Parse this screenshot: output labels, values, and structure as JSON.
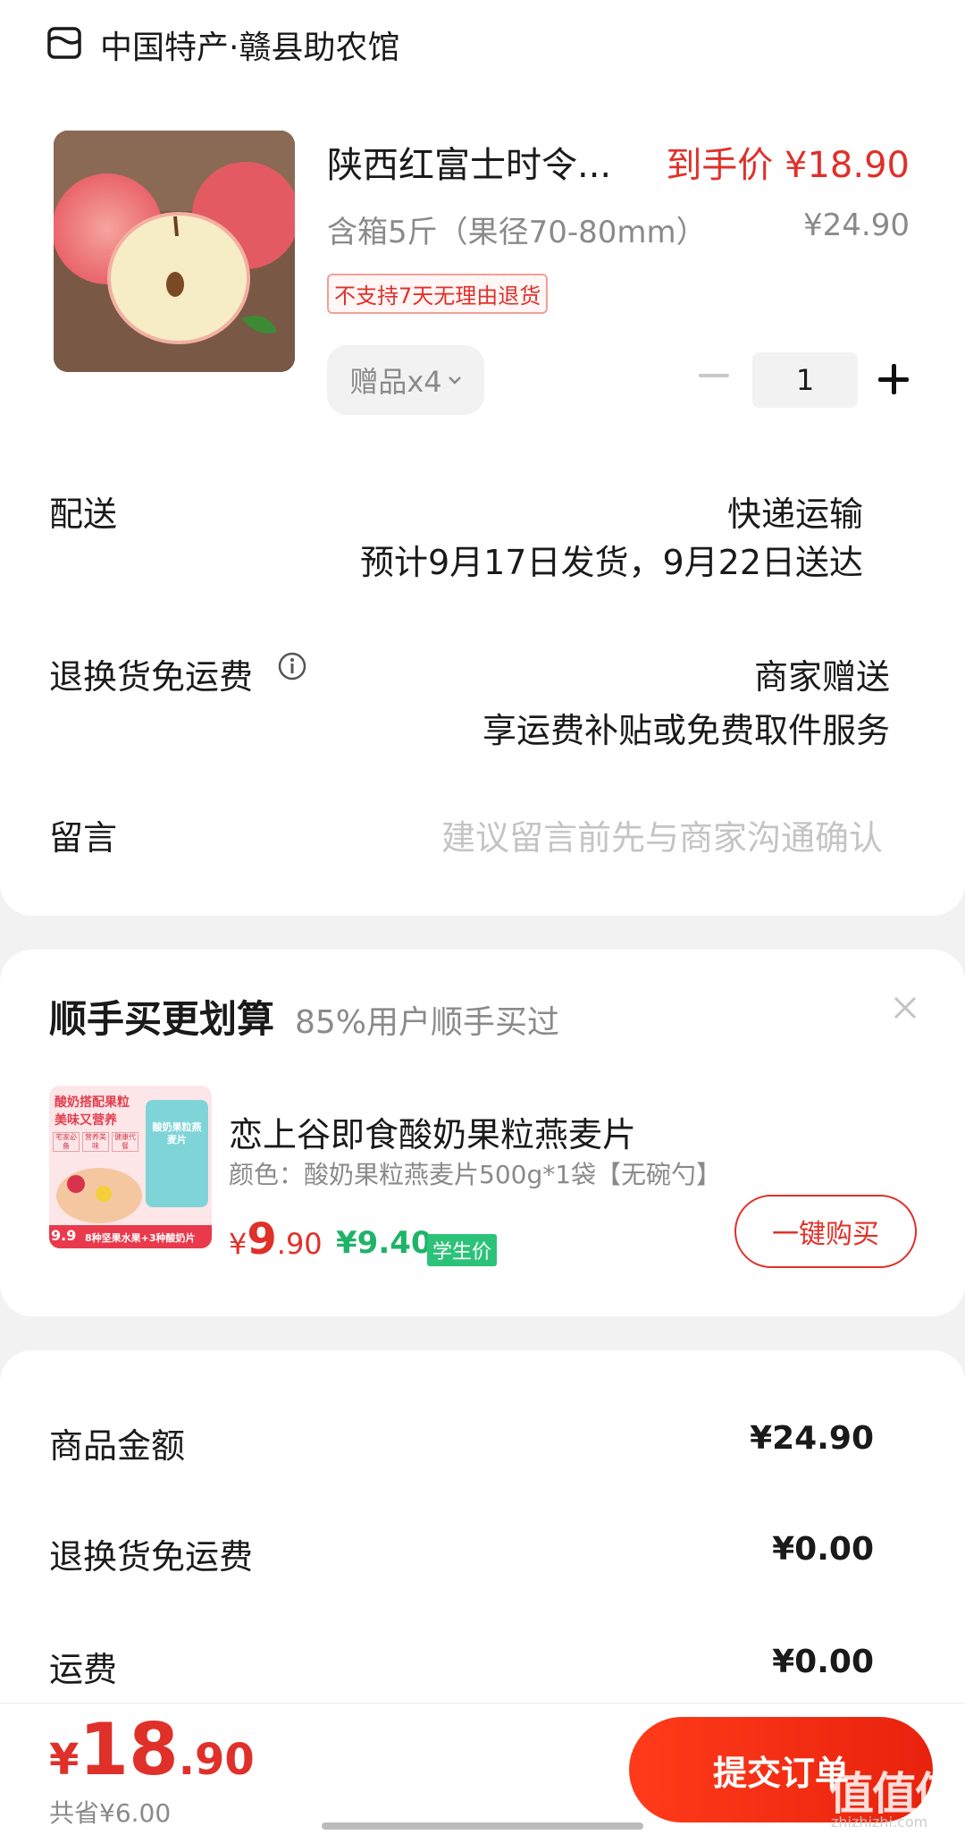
{
  "shop": {
    "name": "中国特产·赣县助农馆"
  },
  "product": {
    "title": "陕西红富士时令...",
    "final_price": "到手价 ¥18.90",
    "spec": "含箱5斤（果径70-80mm）",
    "original_price": "¥24.90",
    "return_tag": "不支持7天无理由退货",
    "gift_label": "赠品x4",
    "quantity": "1"
  },
  "delivery": {
    "label": "配送",
    "method": "快递运输",
    "estimate": "预计9月17日发货，9月22日送达"
  },
  "return_shipping": {
    "label": "退换货免运费",
    "provider": "商家赠送",
    "desc": "享运费补贴或免费取件服务"
  },
  "message": {
    "label": "留言",
    "placeholder": "建议留言前先与商家沟通确认"
  },
  "recommend": {
    "title": "顺手买更划算",
    "subtitle": "85%用户顺手买过",
    "item": {
      "name": "恋上谷即食酸奶果粒燕麦片",
      "spec": "颜色：酸奶果粒燕麦片500g*1袋【无碗勺】",
      "price_symbol": "¥",
      "price_int": "9",
      "price_dec": ".90",
      "student_price": "¥9.40",
      "student_tag": "学生价",
      "buy_label": "一键购买",
      "img_text_1": "酸奶搭配果粒",
      "img_text_2": "美味又营养",
      "img_tags": [
        "宅家必备",
        "营养美味",
        "健康代餐"
      ],
      "img_bottom": "8种坚果水果+3种酸奶片",
      "img_price_badge": "9.9",
      "img_pack_text": "酸奶果粒燕麦片"
    }
  },
  "summary": {
    "rows": [
      {
        "label": "商品金额",
        "value": "¥24.90"
      },
      {
        "label": "退换货免运费",
        "value": "¥0.00"
      },
      {
        "label": "运费",
        "value": "¥0.00"
      }
    ]
  },
  "footer": {
    "price_symbol": "¥",
    "price_int": "18",
    "price_dec": ".90",
    "saved": "共省¥6.00",
    "submit_label": "提交订单",
    "watermark": "值值值",
    "watermark_url": "zhizhizhi.com"
  },
  "colors": {
    "accent": "#e0302a",
    "student_green": "#1fb36a"
  }
}
